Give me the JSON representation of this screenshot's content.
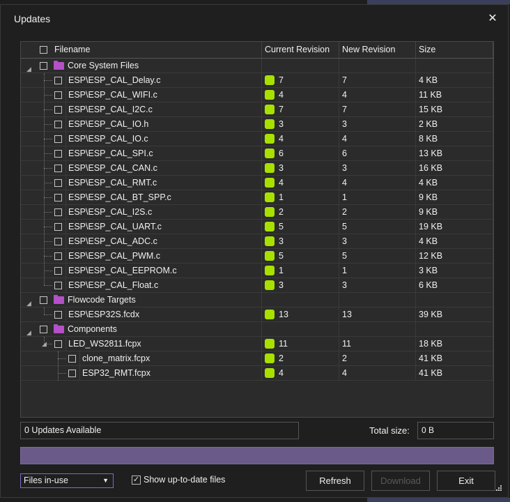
{
  "window": {
    "title": "Updates",
    "close_glyph": "✕"
  },
  "columns": {
    "filename": "Filename",
    "current": "Current Revision",
    "new": "New Revision",
    "size": "Size"
  },
  "groups": [
    {
      "name": "Core System Files",
      "files": [
        {
          "name": "ESP\\ESP_CAL_Delay.c",
          "current": "7",
          "new": "7",
          "size": "4 KB"
        },
        {
          "name": "ESP\\ESP_CAL_WIFI.c",
          "current": "4",
          "new": "4",
          "size": "11 KB"
        },
        {
          "name": "ESP\\ESP_CAL_I2C.c",
          "current": "7",
          "new": "7",
          "size": "15 KB"
        },
        {
          "name": "ESP\\ESP_CAL_IO.h",
          "current": "3",
          "new": "3",
          "size": "2 KB"
        },
        {
          "name": "ESP\\ESP_CAL_IO.c",
          "current": "4",
          "new": "4",
          "size": "8 KB"
        },
        {
          "name": "ESP\\ESP_CAL_SPI.c",
          "current": "6",
          "new": "6",
          "size": "13 KB"
        },
        {
          "name": "ESP\\ESP_CAL_CAN.c",
          "current": "3",
          "new": "3",
          "size": "16 KB"
        },
        {
          "name": "ESP\\ESP_CAL_RMT.c",
          "current": "4",
          "new": "4",
          "size": "4 KB"
        },
        {
          "name": "ESP\\ESP_CAL_BT_SPP.c",
          "current": "1",
          "new": "1",
          "size": "9 KB"
        },
        {
          "name": "ESP\\ESP_CAL_I2S.c",
          "current": "2",
          "new": "2",
          "size": "9 KB"
        },
        {
          "name": "ESP\\ESP_CAL_UART.c",
          "current": "5",
          "new": "5",
          "size": "19 KB"
        },
        {
          "name": "ESP\\ESP_CAL_ADC.c",
          "current": "3",
          "new": "3",
          "size": "4 KB"
        },
        {
          "name": "ESP\\ESP_CAL_PWM.c",
          "current": "5",
          "new": "5",
          "size": "12 KB"
        },
        {
          "name": "ESP\\ESP_CAL_EEPROM.c",
          "current": "1",
          "new": "1",
          "size": "3 KB"
        },
        {
          "name": "ESP\\ESP_CAL_Float.c",
          "current": "3",
          "new": "3",
          "size": "6 KB"
        }
      ]
    },
    {
      "name": "Flowcode Targets",
      "files": [
        {
          "name": "ESP\\ESP32S.fcdx",
          "current": "13",
          "new": "13",
          "size": "39 KB"
        }
      ]
    },
    {
      "name": "Components",
      "files": [
        {
          "name": "LED_WS2811.fcpx",
          "current": "11",
          "new": "11",
          "size": "18 KB",
          "children": [
            {
              "name": "clone_matrix.fcpx",
              "current": "2",
              "new": "2",
              "size": "41 KB"
            },
            {
              "name": "ESP32_RMT.fcpx",
              "current": "4",
              "new": "4",
              "size": "41 KB"
            }
          ]
        }
      ]
    }
  ],
  "footer": {
    "status": "0 Updates Available",
    "total_label": "Total size:",
    "total_value": "0 B",
    "filter_value": "Files in-use",
    "show_uptodate_label": "Show up-to-date files",
    "show_uptodate_checked": true,
    "refresh": "Refresh",
    "download": "Download",
    "exit": "Exit"
  },
  "colors": {
    "revision_badge": "#a8e000",
    "folder": "#b450c8",
    "progress": "#6a5a8a"
  }
}
